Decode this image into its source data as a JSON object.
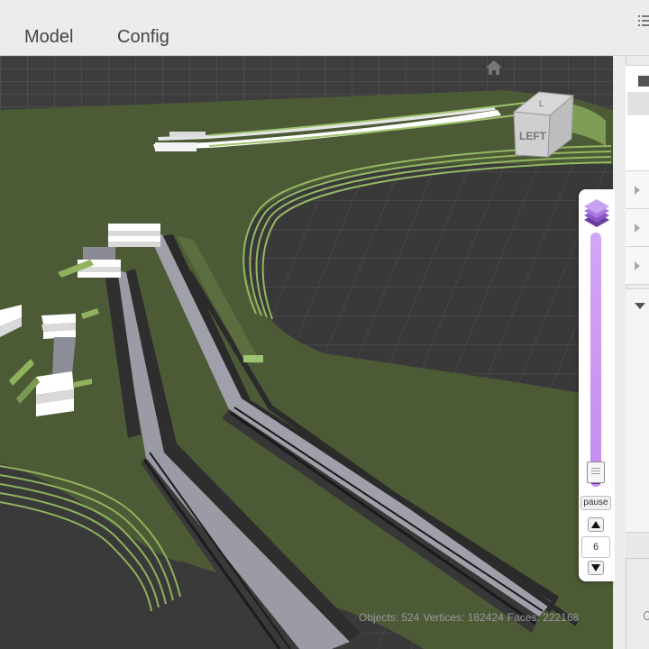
{
  "tabs": [
    {
      "label": "Model"
    },
    {
      "label": "Config"
    }
  ],
  "viewport": {
    "view_cube_label": "LEFT",
    "view_cube_top_label": "L"
  },
  "stats": {
    "objects": "Objects: 524",
    "vertices": "Vertices: 182424",
    "faces": "Faces: 222168"
  },
  "layer_slider": {
    "pause_label": "pause",
    "layer_value": "6"
  },
  "icons": {
    "menu": "menu-list-icon",
    "home": "home-icon",
    "layers": "layers-stack-icon",
    "up": "arrow-up-icon",
    "down": "arrow-down-icon"
  },
  "colors": {
    "ground": "#4c5a36",
    "grid": "#3a3a3a",
    "slider_track": "#c58bf0",
    "slider_bottom": "#6a2c91"
  }
}
